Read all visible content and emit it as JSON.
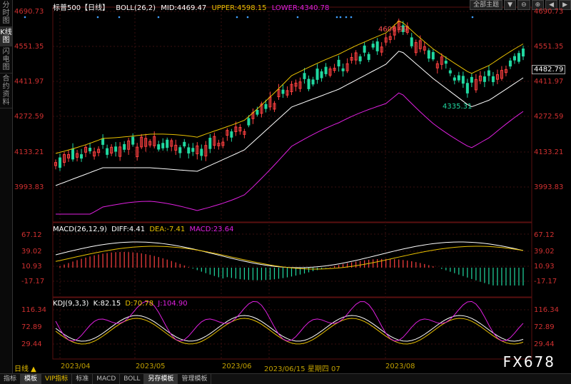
{
  "sidebar": {
    "tabs": [
      {
        "label": "分时图",
        "active": false
      },
      {
        "label": "K线图",
        "active": true
      },
      {
        "label": "闪电图",
        "active": false
      },
      {
        "label": "合约资料",
        "active": false
      }
    ]
  },
  "header": {
    "symbol": "标普500",
    "period": "【日线】",
    "boll_label": "BOLL(26,2)",
    "mid": "MID:4469.47",
    "upper": "UPPER:4598.15",
    "lower": "LOWER:4340.78",
    "theme_select": "全部主题"
  },
  "price_axis": {
    "labels": [
      "4690.73",
      "4551.35",
      "4411.97",
      "4272.59",
      "4133.21",
      "3993.83"
    ],
    "current": "4482.79"
  },
  "annotations": {
    "high": "4606.99",
    "low": "4335.31"
  },
  "macd": {
    "label": "MACD(26,12,9)",
    "diff": "DIFF:4.41",
    "dea": "DEA:-7.41",
    "macd": "MACD:23.64",
    "axis": [
      "67.12",
      "39.02",
      "10.93",
      "-17.17"
    ]
  },
  "kdj": {
    "label": "KDJ(9,3,3)",
    "k": "K:82.15",
    "d": "D:70.78",
    "j": "J:104.90",
    "axis": [
      "116.34",
      "72.89",
      "29.44"
    ]
  },
  "x_axis": {
    "timeframe": "日线 ▲",
    "ticks": [
      "2023/04",
      "2023/05",
      "2023/06",
      "2023/06/15 星期四 07",
      "2023/08"
    ]
  },
  "bottom_tabs": [
    "指标",
    "模板",
    "VIP指标",
    "标准",
    "MACD",
    "BOLL",
    "另存模板",
    "管理模板"
  ],
  "watermark": "FX678",
  "colors": {
    "up": "#ff4040",
    "down": "#20d8a0",
    "mid": "#ffffff",
    "upper": "#e8c000",
    "lower": "#e020e0"
  }
}
